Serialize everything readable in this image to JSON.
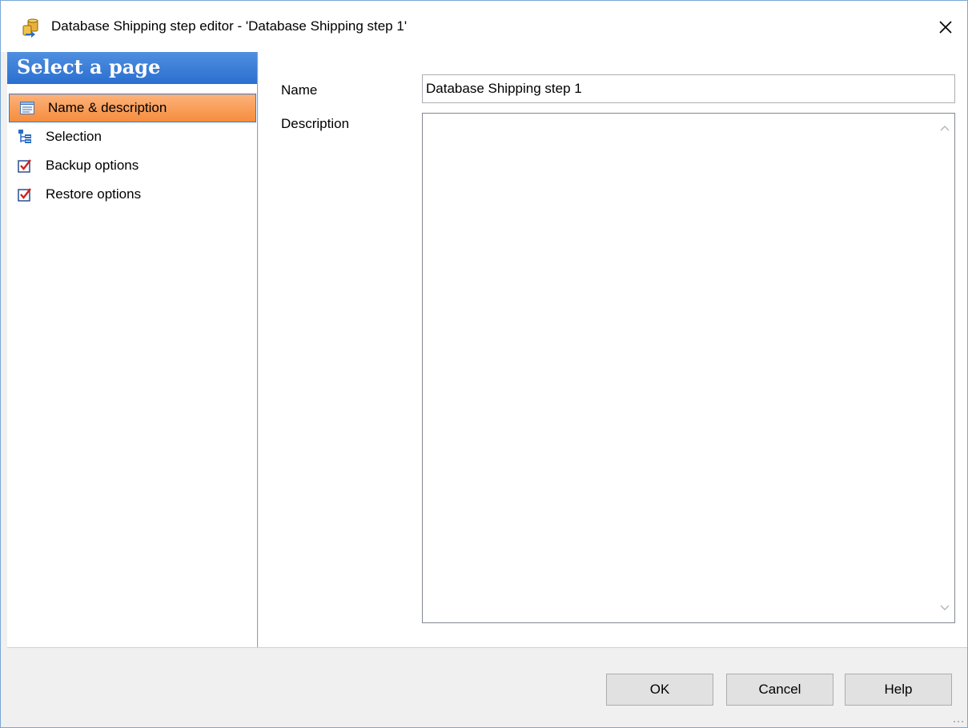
{
  "window": {
    "title": "Database Shipping step editor - 'Database Shipping step 1'",
    "app_icon": "database-shipping-icon",
    "close_icon": "close-icon"
  },
  "sidebar": {
    "header": "Select a page",
    "items": [
      {
        "label": "Name & description",
        "icon": "list-page-icon",
        "active": true
      },
      {
        "label": "Selection",
        "icon": "tree-icon",
        "active": false
      },
      {
        "label": "Backup options",
        "icon": "checkbox-options-icon",
        "active": false
      },
      {
        "label": "Restore options",
        "icon": "checkbox-options-icon",
        "active": false
      }
    ]
  },
  "form": {
    "name_label": "Name",
    "name_value": "Database Shipping step 1",
    "description_label": "Description",
    "description_value": ""
  },
  "buttons": {
    "ok": "OK",
    "cancel": "Cancel",
    "help": "Help"
  },
  "colors": {
    "sidebar_header": "#2a6fd0",
    "active_item": "#f58d3e",
    "active_border": "#3c78c8"
  }
}
